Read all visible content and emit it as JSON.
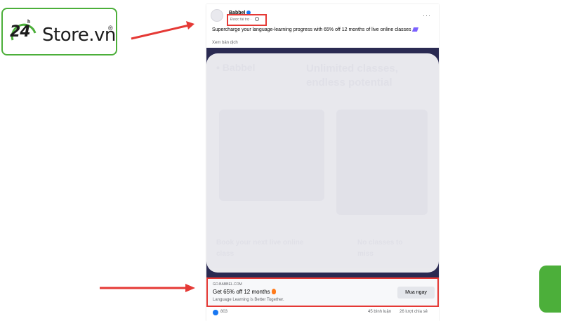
{
  "logo": {
    "number": "24",
    "h": "h",
    "text": "Store.vn",
    "registered": "®"
  },
  "post": {
    "page_name": "Babbel",
    "sponsored": "Được tài trợ ·",
    "body": "Supercharge your language-learning progress with 65% off 12 months of live online classes",
    "translate": "Xem bản dịch",
    "more": "···"
  },
  "ad_image": {
    "ghost_brand": "• Babbel",
    "ghost_headline": "Unlimited classes, endless potential",
    "ghost_caption": "Book your next live online class",
    "ghost_badge": "No classes to miss"
  },
  "link": {
    "domain": "GO.BABBEL.COM",
    "title": "Get 65% off 12 months",
    "description": "Language Learning is Better Together.",
    "button": "Mua ngay"
  },
  "stats": {
    "likes": "803",
    "comments": "45 bình luận",
    "shares": "26 lượt chia sẻ"
  },
  "colors": {
    "accent_red": "#e53935",
    "brand_green": "#4caf3a",
    "fb_blue": "#1877f2"
  }
}
